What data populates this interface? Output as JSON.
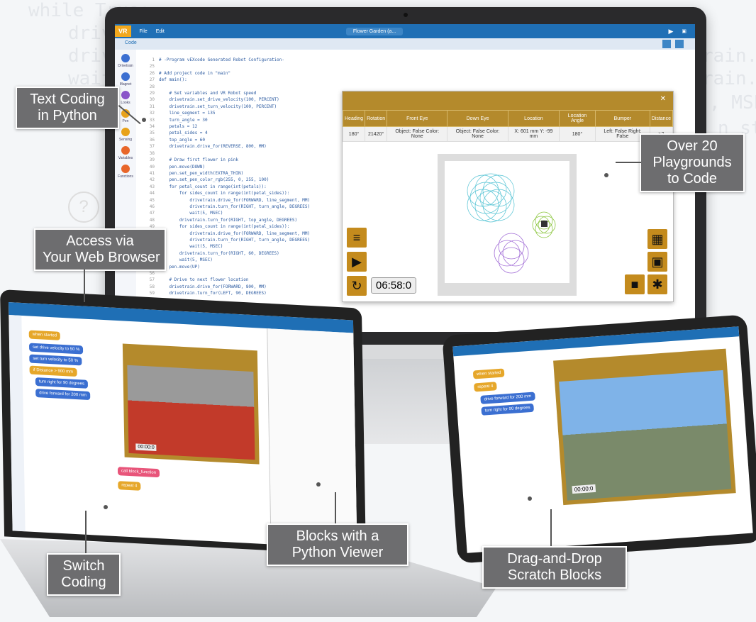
{
  "background_code": {
    "lines": [
      "while True:",
      "driv",
      "driv",
      "wait",
      "rain.",
      "rain.",
      ", MSE",
      "n_sta"
    ]
  },
  "monitor": {
    "logo": "VR",
    "menu": [
      "File",
      "Edit"
    ],
    "project_pill": "Flower Garden (a...",
    "tab_label": "Code",
    "categories": [
      {
        "label": "Drivetrain",
        "color": "#3b6fd1"
      },
      {
        "label": "Magnet",
        "color": "#3b6fd1"
      },
      {
        "label": "Looks",
        "color": "#8a55c9"
      },
      {
        "label": "Pen",
        "color": "#e8a21a"
      },
      {
        "label": "Sensing",
        "color": "#e8a21a"
      },
      {
        "label": "Variables",
        "color": "#e8662a"
      },
      {
        "label": "Functions",
        "color": "#e8662a"
      }
    ],
    "line_numbers": "1\n25\n26\n27\n28\n29\n30\n31\n32\n33\n34\n35\n36\n37\n38\n39\n40\n41\n42\n43\n44\n45\n46\n47\n48\n49\n50\n51\n52\n53\n54\n55\n56\n57\n58\n59",
    "code": "# -Program vEXcode Generated Robot Configuration-\n\n# Add project code in \"main\"\ndef main():\n\n    # Set variables and VR Robot speed\n    drivetrain.set_drive_velocity(100, PERCENT)\n    drivetrain.set_turn_velocity(100, PERCENT)\n    line_segment = 135\n    turn_angle = 30\n    petals = 12\n    petal_sides = 4\n    top_angle = 60\n    drivetrain.drive_for(REVERSE, 800, MM)\n\n    # Draw first flower in pink\n    pen.move(DOWN)\n    pen.set_pen_width(EXTRA_THIN)\n    pen.set_pen_color_rgb(255, 0, 255, 100)\n    for petal_count in range(int(petals)):\n        for sides_count in range(int(petal_sides)):\n            drivetrain.drive_for(FORWARD, line_segment, MM)\n            drivetrain.turn_for(RIGHT, turn_angle, DEGREES)\n            wait(5, MSEC)\n        drivetrain.turn_for(RIGHT, top_angle, DEGREES)\n        for sides_count in range(int(petal_sides)):\n            drivetrain.drive_for(FORWARD, line_segment, MM)\n            drivetrain.turn_for(RIGHT, turn_angle, DEGREES)\n            wait(5, MSEC)\n        drivetrain.turn_for(RIGHT, 60, DEGREES)\n        wait(5, MSEC)\n    pen.move(UP)\n\n    # Drive to next flower location\n    drivetrain.drive_for(FORWARD, 800, MM)\n    drivetrain.turn_for(LEFT, 90, DEGREES)"
  },
  "playground": {
    "columns": [
      "Heading",
      "Rotation",
      "Front Eye",
      "Down Eye",
      "Location",
      "Location Angle",
      "Bumper",
      "Distance"
    ],
    "row": [
      "180°",
      "21420°",
      "Object: False Color: None",
      "Object: False Color: None",
      "X: 601 mm Y: -99 mm",
      "180°",
      "Left: False Right: False",
      ">3"
    ],
    "timer": "06:58:0"
  },
  "laptop": {
    "timer": "00:00:0",
    "blocks": [
      "when started",
      "set drive velocity to 50 %",
      "set turn velocity to 50 %",
      "if Distance > 900 mm",
      "turn right for 90 degrees",
      "drive forward for 200 mm",
      "call block_function",
      "repeat 4"
    ]
  },
  "tablet": {
    "timer": "00:00:0",
    "blocks": [
      "when started",
      "repeat 4",
      "drive forward for 200 mm",
      "turn right for 90 degrees"
    ]
  },
  "callouts": {
    "text_coding": "Text Coding\nin Python",
    "playgrounds": "Over 20\nPlaygrounds\nto Code",
    "browser": "Access via\nYour Web Browser",
    "switch": "Switch\nCoding",
    "blocks_viewer": "Blocks with a\nPython Viewer",
    "drag_drop": "Drag-and-Drop\nScratch Blocks"
  }
}
